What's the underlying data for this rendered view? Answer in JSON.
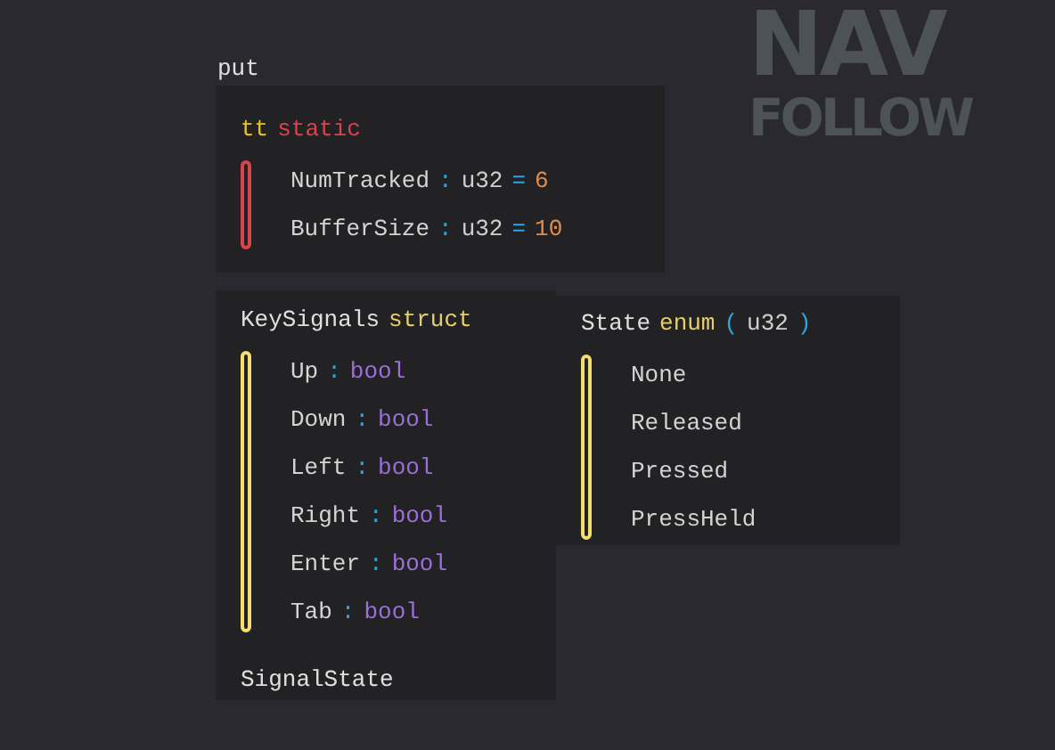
{
  "logo": {
    "line_1": "NAV",
    "line_2": "FOLLOW"
  },
  "cut_label": "put",
  "nodes": [
    {
      "kind": "static",
      "name": "tt",
      "keyword": "static",
      "color": "#d9434b",
      "fields": [
        {
          "name": "NumTracked",
          "colon": ":",
          "type": "u32",
          "equals": "=",
          "value": "6"
        },
        {
          "name": "BufferSize",
          "colon": ":",
          "type": "u32",
          "equals": "=",
          "value": "10"
        }
      ]
    },
    {
      "kind": "struct",
      "name": "KeySignals",
      "keyword": "struct",
      "color": "#f5dd6e",
      "fields": [
        {
          "name": "Up",
          "colon": ":",
          "type": "bool"
        },
        {
          "name": "Down",
          "colon": ":",
          "type": "bool"
        },
        {
          "name": "Left",
          "colon": ":",
          "type": "bool"
        },
        {
          "name": "Right",
          "colon": ":",
          "type": "bool"
        },
        {
          "name": "Enter",
          "colon": ":",
          "type": "bool"
        },
        {
          "name": "Tab",
          "colon": ":",
          "type": "bool"
        }
      ],
      "next_label": "SignalState"
    },
    {
      "kind": "enum",
      "name": "State",
      "keyword": "enum",
      "open": "(",
      "type": "u32",
      "close": ")",
      "color": "#f5dd6e",
      "fields": [
        {
          "name": "None"
        },
        {
          "name": "Released"
        },
        {
          "name": "Pressed"
        },
        {
          "name": "PressHeld"
        }
      ]
    }
  ]
}
